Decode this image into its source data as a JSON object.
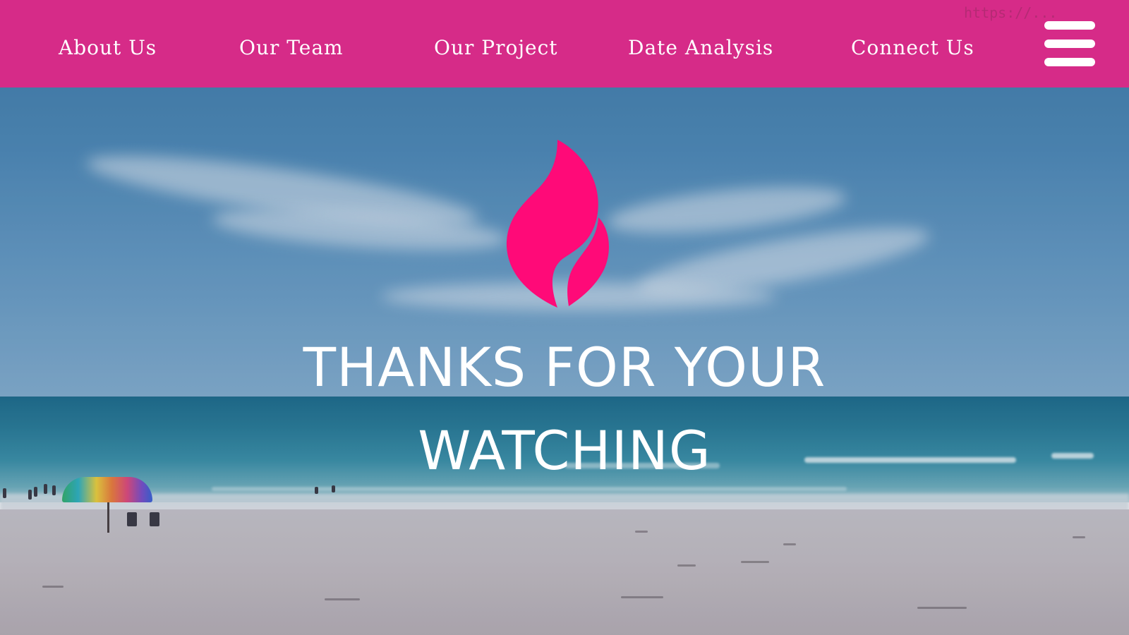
{
  "nav": {
    "items": [
      {
        "label": "About Us"
      },
      {
        "label": "Our Team"
      },
      {
        "label": "Our Project"
      },
      {
        "label": "Date Analysis"
      },
      {
        "label": "Connect Us"
      }
    ],
    "menu_icon": "hamburger-menu-icon",
    "watermark": "https://..."
  },
  "hero": {
    "logo_icon": "flame-logo-icon",
    "headline_line1": "THANKS FOR YOUR",
    "headline_line2": "WATCHING"
  },
  "colors": {
    "nav_background": "#d62b88",
    "logo_color": "#ff0a78",
    "text_color": "#ffffff"
  }
}
